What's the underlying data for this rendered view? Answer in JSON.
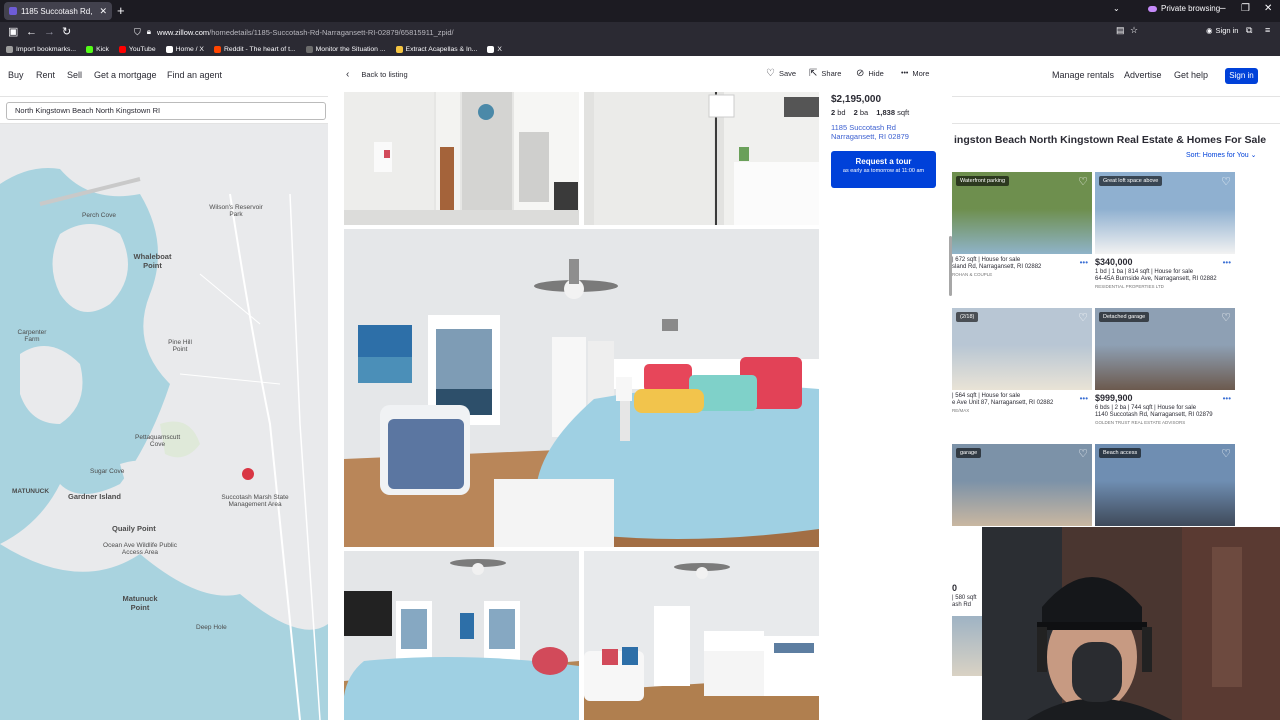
{
  "browser": {
    "tab_title": "1185 Succotash Rd, Narragans",
    "tab_close": "✕",
    "new_tab": "+",
    "private_label": "Private browsing",
    "url_host": "www.zillow.com",
    "url_path": "/homedetails/1185-Succotash-Rd-Narragansett-RI-02879/65815911_zpid/",
    "sign_in": "Sign in",
    "bookmarks": [
      {
        "label": "Import bookmarks...",
        "color": "#9e9e9e"
      },
      {
        "label": "Kick",
        "color": "#53fc18"
      },
      {
        "label": "YouTube",
        "color": "#ff0000"
      },
      {
        "label": "Home / X",
        "color": "#ffffff"
      },
      {
        "label": "Reddit - The heart of t...",
        "color": "#ff4500"
      },
      {
        "label": "Monitor the Situation ...",
        "color": "#6c6c6c"
      },
      {
        "label": "Extract Acapellas & In...",
        "color": "#f5c542"
      },
      {
        "label": "X",
        "color": "#ffffff"
      }
    ]
  },
  "site": {
    "nav_left": [
      "Buy",
      "Rent",
      "Sell",
      "Get a mortgage",
      "Find an agent"
    ],
    "nav_right": [
      "Manage rentals",
      "Advertise",
      "Get help"
    ],
    "sign_in": "Sign in",
    "search_value": "North Kingstown Beach North Kingstown RI",
    "results_title": "ingston Beach North Kingstown Real Estate & Homes For Sale",
    "sort_label": "Sort: Homes for You ⌄"
  },
  "map_labels": [
    "Perch Cove",
    "Wilson's Reservoir Park",
    "Whaleboat Point",
    "Carpenter Farm",
    "Pine Hill Point",
    "Pettaquamscutt Cove",
    "Gardner Island",
    "Succotash Marsh State Management Area",
    "Quaily Point",
    "Matunuck Point",
    "MATUNUCK",
    "Deep Hole",
    "Sugar Cove",
    "Ocean Ave Wildlife Public Access Area"
  ],
  "listing_cards": [
    {
      "badge": "Waterfront parking",
      "price": "",
      "meta": "| 672 sqft | House for sale",
      "addr": "sland Rd, Narragansett, RI 02882",
      "broker": "ROHAN & COUPLE"
    },
    {
      "badge": "Great loft space above",
      "price": "$340,000",
      "meta": "1 bd | 1 ba | 814 sqft | House for sale",
      "addr": "64-45A Burnside Ave, Narragansett, RI 02882",
      "broker": "RESIDENTIAL PROPERTIES LTD"
    },
    {
      "badge": "(2/18)",
      "price": "",
      "meta": "| 564 sqft | House for sale",
      "addr": "e Ave Unit 87, Narragansett, RI 02882",
      "broker": "RE/MAX"
    },
    {
      "badge": "Detached garage",
      "price": "$999,900",
      "meta": "6 bds | 2 ba | 744 sqft | House for sale",
      "addr": "1140 Succotash Rd, Narragansett, RI 02879",
      "broker": "GOLDEN TRUST REAL ESTATE ADVISORS"
    },
    {
      "badge": "garage",
      "price": "",
      "meta": "",
      "addr": "",
      "broker": ""
    },
    {
      "badge": "Beach access",
      "price": "",
      "meta": "",
      "addr": "",
      "broker": ""
    }
  ],
  "partial_left": [
    {
      "price": "0",
      "meta": "| 580 sqft",
      "addr": "ash Rd"
    },
    {
      "price": "0",
      "meta": "| 564 sqft",
      "addr": "e Ave #4"
    }
  ],
  "modal": {
    "back_label": "Back to listing",
    "actions": [
      {
        "icon": "heart-icon",
        "glyph": "♡",
        "label": "Save"
      },
      {
        "icon": "share-icon",
        "glyph": "⇱",
        "label": "Share"
      },
      {
        "icon": "hide-icon",
        "glyph": "⊘",
        "label": "Hide"
      },
      {
        "icon": "more-icon",
        "glyph": "•••",
        "label": "More"
      }
    ],
    "price": "$2,195,000",
    "beds": "2",
    "beds_label": "bd",
    "baths": "2",
    "baths_label": "ba",
    "sqft": "1,838",
    "sqft_label": "sqft",
    "address_line1": "1185 Succotash Rd",
    "address_line2": "Narragansett, RI 02879",
    "tour_button": "Request a tour",
    "tour_sub": "as early as tomorrow at 11:00 am"
  }
}
